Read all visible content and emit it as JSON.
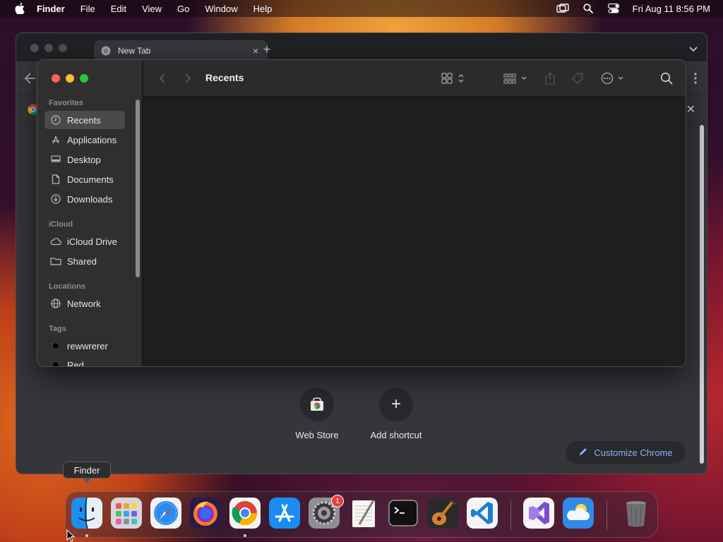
{
  "menubar": {
    "app_name": "Finder",
    "items": [
      "File",
      "Edit",
      "View",
      "Go",
      "Window",
      "Help"
    ],
    "clock": "Fri Aug 11  8:56 PM"
  },
  "chrome": {
    "tab_title": "New Tab",
    "new_tab_symbol": "+",
    "tab_close_symbol": "×",
    "infobar_close_symbol": "✕",
    "shortcuts": [
      {
        "label": "Web Store",
        "icon": "web-store-icon"
      },
      {
        "label": "Add shortcut",
        "icon": "plus-icon",
        "symbol": "+"
      }
    ],
    "customize_label": "Customize Chrome"
  },
  "finder": {
    "title": "Recents",
    "sidebar": {
      "favorites_header": "Favorites",
      "favorites": [
        {
          "label": "Recents",
          "icon": "clock-icon"
        },
        {
          "label": "Applications",
          "icon": "applications-icon"
        },
        {
          "label": "Desktop",
          "icon": "desktop-icon"
        },
        {
          "label": "Documents",
          "icon": "document-icon"
        },
        {
          "label": "Downloads",
          "icon": "download-icon"
        }
      ],
      "icloud_header": "iCloud",
      "icloud": [
        {
          "label": "iCloud Drive",
          "icon": "cloud-icon"
        },
        {
          "label": "Shared",
          "icon": "shared-folder-icon"
        }
      ],
      "locations_header": "Locations",
      "locations": [
        {
          "label": "Network",
          "icon": "globe-icon"
        }
      ],
      "tags_header": "Tags",
      "tags": [
        {
          "label": "rewwrerer"
        },
        {
          "label": "Red"
        }
      ]
    }
  },
  "tooltip": "Finder",
  "dock": {
    "apps": [
      {
        "name": "Finder",
        "icon": "finder-icon",
        "running": true
      },
      {
        "name": "Launchpad",
        "icon": "launchpad-icon"
      },
      {
        "name": "Safari",
        "icon": "safari-icon"
      },
      {
        "name": "Firefox",
        "icon": "firefox-icon"
      },
      {
        "name": "Google Chrome",
        "icon": "chrome-icon",
        "running": true
      },
      {
        "name": "App Store",
        "icon": "app-store-icon"
      },
      {
        "name": "System Settings",
        "icon": "system-settings-icon",
        "badge": "1"
      },
      {
        "name": "TextEdit",
        "icon": "textedit-icon"
      },
      {
        "name": "Terminal",
        "icon": "terminal-icon"
      },
      {
        "name": "GarageBand",
        "icon": "garageband-icon"
      },
      {
        "name": "Visual Studio Code",
        "icon": "vscode-icon"
      },
      {
        "name": "Visual Studio",
        "icon": "visual-studio-icon"
      },
      {
        "name": "Weather",
        "icon": "weather-icon"
      },
      {
        "name": "Trash",
        "icon": "trash-icon"
      }
    ]
  }
}
